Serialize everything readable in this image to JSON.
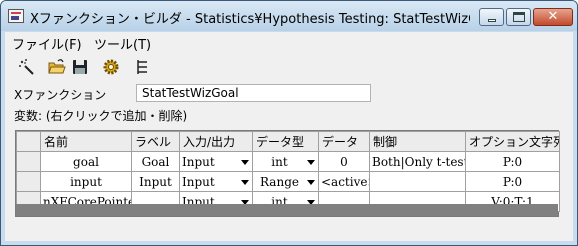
{
  "window": {
    "title": "Xファンクション・ビルダ - Statistics¥Hypothesis Testing: StatTestWizGo...",
    "close_glyph": "✕"
  },
  "menu": [
    "ファイル(F)",
    "ツール(T)"
  ],
  "toolbar": {
    "icons": [
      "magic-wand-icon",
      "open-folder-icon",
      "save-disk-icon",
      "gear-icon",
      "tree-list-icon"
    ]
  },
  "form": {
    "xfunction_label": "Xファンクション",
    "xfunction_value": "StatTestWizGoal",
    "variables_label": "変数: (右クリックで追加・削除)"
  },
  "grid": {
    "columns": [
      "名前",
      "ラベル",
      "入力/出力",
      "データ型",
      "データ",
      "制御",
      "オプション文字列"
    ],
    "rows": [
      {
        "name": "goal",
        "label": "Goal",
        "io": "Input",
        "type": "int",
        "data": "0",
        "control": "Both|Only t-test",
        "option": "P:0"
      },
      {
        "name": "input",
        "label": "Input",
        "io": "Input",
        "type": "Range",
        "data": "<active>",
        "control": "",
        "option": "P:0"
      },
      {
        "name": "nXFCorePointer",
        "label": "",
        "io": "Input",
        "type": "int",
        "data": "",
        "control": "",
        "option": "V:0;T:1"
      }
    ]
  }
}
